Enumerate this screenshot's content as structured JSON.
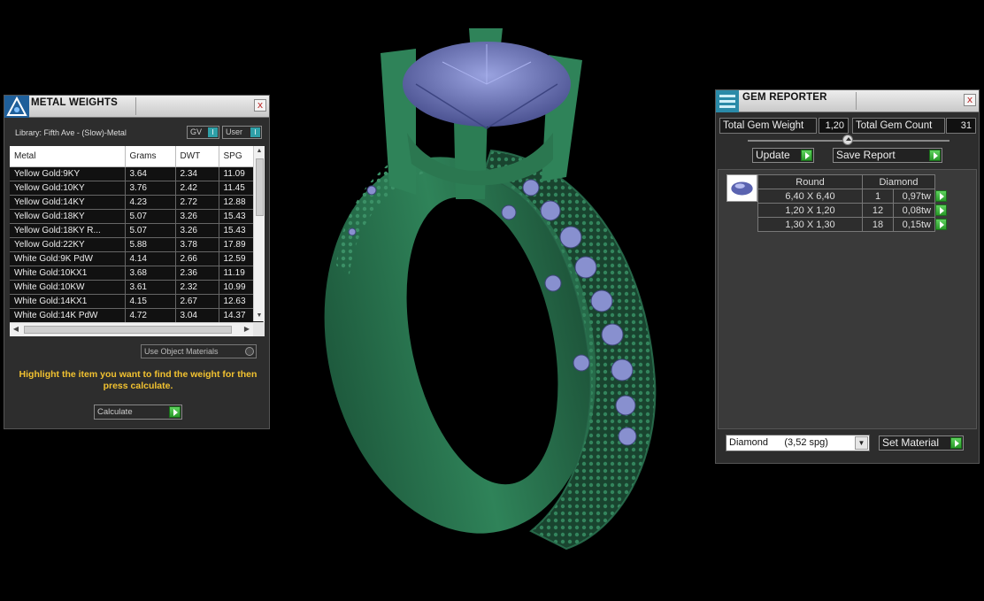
{
  "metal_weights": {
    "title": "METAL WEIGHTS",
    "library": "Library: Fifth Ave - (Slow)-Metal",
    "toggle_gv": "GV",
    "toggle_user": "User",
    "toggle_mark": "I",
    "columns": [
      "Metal",
      "Grams",
      "DWT",
      "SPG"
    ],
    "rows": [
      [
        "Yellow Gold:9KY",
        "3.64",
        "2.34",
        "11.09"
      ],
      [
        "Yellow Gold:10KY",
        "3.76",
        "2.42",
        "11.45"
      ],
      [
        "Yellow Gold:14KY",
        "4.23",
        "2.72",
        "12.88"
      ],
      [
        "Yellow Gold:18KY",
        "5.07",
        "3.26",
        "15.43"
      ],
      [
        "Yellow Gold:18KY R...",
        "5.07",
        "3.26",
        "15.43"
      ],
      [
        "Yellow Gold:22KY",
        "5.88",
        "3.78",
        "17.89"
      ],
      [
        "White Gold:9K PdW",
        "4.14",
        "2.66",
        "12.59"
      ],
      [
        "White Gold:10KX1",
        "3.68",
        "2.36",
        "11.19"
      ],
      [
        "White Gold:10KW",
        "3.61",
        "2.32",
        "10.99"
      ],
      [
        "White Gold:14KX1",
        "4.15",
        "2.67",
        "12.63"
      ],
      [
        "White Gold:14K PdW",
        "4.72",
        "3.04",
        "14.37"
      ]
    ],
    "use_object_materials": "Use Object Materials",
    "hint": "Highlight the item you want to find the weight for then press calculate.",
    "calculate_label": "Calculate",
    "close": "x"
  },
  "gem_reporter": {
    "title": "GEM REPORTER",
    "total_weight_label": "Total Gem Weight",
    "total_weight_value": "1,20",
    "total_count_label": "Total Gem Count",
    "total_count_value": "31",
    "update_label": "Update",
    "save_report_label": "Save Report",
    "shape_header": "Round",
    "material_header": "Diamond",
    "rows": [
      {
        "size": "6,40 X 6,40",
        "count": "1",
        "weight": "0,97tw"
      },
      {
        "size": "1,20 X 1,20",
        "count": "12",
        "weight": "0,08tw"
      },
      {
        "size": "1,30 X 1,30",
        "count": "18",
        "weight": "0,15tw"
      }
    ],
    "material_select": "Diamond      (3,52 spg)",
    "set_material_label": "Set Material",
    "close": "x"
  },
  "colors": {
    "metal": "#2f7a56",
    "stone": "#7b85c8",
    "hint_text": "#f2c230",
    "button_arrow": "#3cb43c"
  }
}
